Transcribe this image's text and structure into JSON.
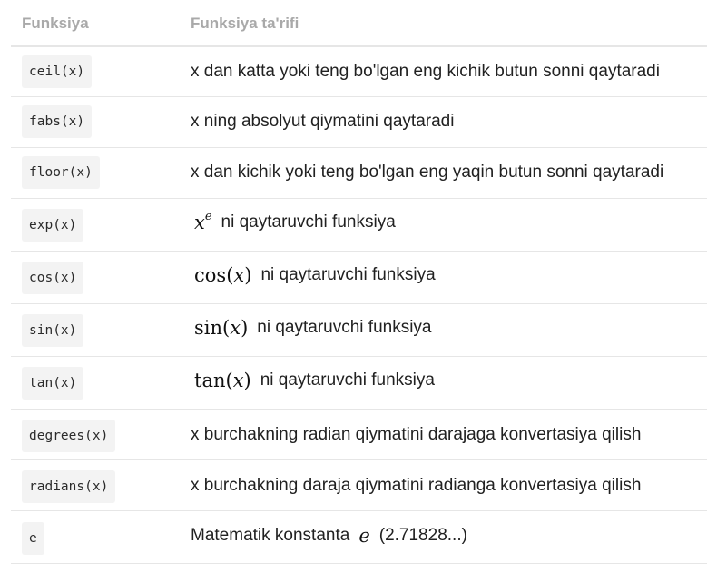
{
  "header": {
    "col1": "Funksiya",
    "col2": "Funksiya ta'rifi"
  },
  "rows": [
    {
      "code": "ceil(x)",
      "desc": "x dan katta yoki teng bo'lgan eng kichik butun sonni qaytaradi"
    },
    {
      "code": "fabs(x)",
      "desc": "x ning absolyut qiymatini qaytaradi"
    },
    {
      "code": "floor(x)",
      "desc": "x dan kichik yoki teng bo'lgan eng yaqin butun sonni qaytaradi"
    },
    {
      "code": "exp(x)",
      "math_base": "x",
      "math_exp": "e",
      "desc": "ni qaytaruvchi funksiya"
    },
    {
      "code": "cos(x)",
      "math_fn": "cos",
      "math_arg": "x",
      "desc": "ni qaytaruvchi funksiya"
    },
    {
      "code": "sin(x)",
      "math_fn": "sin",
      "math_arg": "x",
      "desc": "ni qaytaruvchi funksiya"
    },
    {
      "code": "tan(x)",
      "math_fn": "tan",
      "math_arg": "x",
      "desc": "ni qaytaruvchi funksiya"
    },
    {
      "code": "degrees(x)",
      "desc": "x burchakning radian qiymatini darajaga konvertasiya qilish"
    },
    {
      "code": "radians(x)",
      "desc": "x burchakning daraja qiymatini radianga konvertasiya qilish"
    },
    {
      "code": "e",
      "desc_before": "Matematik konstanta",
      "math_const": "e",
      "desc_after": "(2.71828...)"
    }
  ]
}
